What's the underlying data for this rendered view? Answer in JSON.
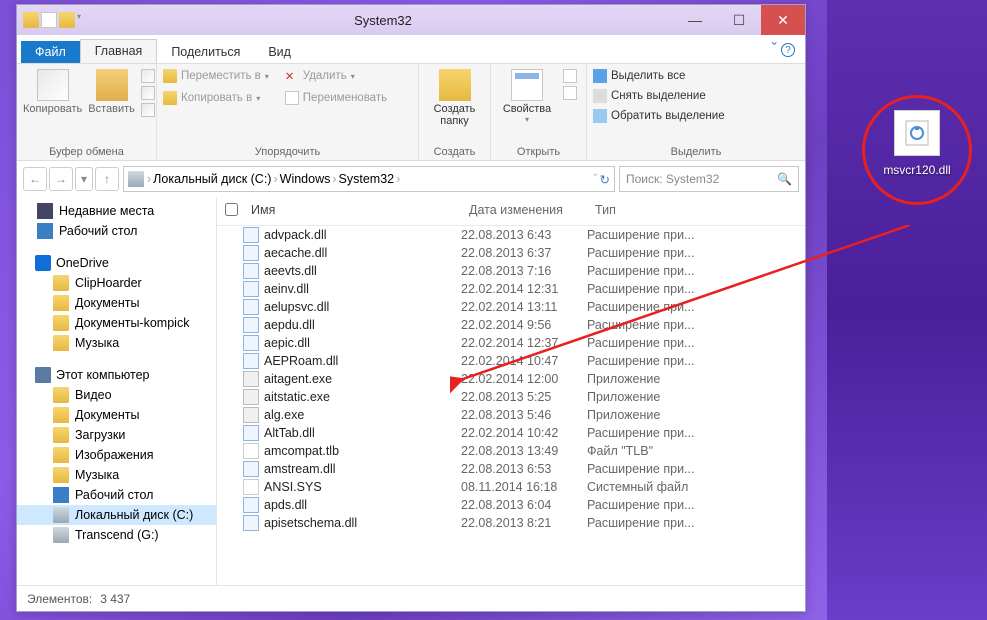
{
  "window": {
    "title": "System32"
  },
  "tabs": {
    "file": "Файл",
    "home": "Главная",
    "share": "Поделиться",
    "view": "Вид"
  },
  "ribbon": {
    "copy": "Копировать",
    "paste": "Вставить",
    "clipboard_group": "Буфер обмена",
    "move": "Переместить в",
    "copy_to": "Копировать в",
    "delete": "Удалить",
    "rename": "Переименовать",
    "organize_group": "Упорядочить",
    "newfolder_l1": "Создать",
    "newfolder_l2": "папку",
    "create_group": "Создать",
    "properties": "Свойства",
    "open_group": "Открыть",
    "select_all": "Выделить все",
    "deselect": "Снять выделение",
    "invert": "Обратить выделение",
    "select_group": "Выделить"
  },
  "breadcrumb": {
    "root": "Локальный диск (C:)",
    "windows": "Windows",
    "current": "System32"
  },
  "search": {
    "placeholder": "Поиск: System32"
  },
  "tree": {
    "recent": "Недавние места",
    "desktop": "Рабочий стол",
    "onedrive": "OneDrive",
    "cliphoarder": "ClipHoarder",
    "documents": "Документы",
    "documents_kompick": "Документы-kompick",
    "music": "Музыка",
    "this_pc": "Этот компьютер",
    "videos": "Видео",
    "documents2": "Документы",
    "downloads": "Загрузки",
    "pictures": "Изображения",
    "music2": "Музыка",
    "desktop2": "Рабочий стол",
    "cdrive": "Локальный диск (C:)",
    "transcend": "Transcend (G:)"
  },
  "cols": {
    "name": "Имя",
    "date": "Дата изменения",
    "type": "Тип"
  },
  "files": [
    {
      "name": "advpack.dll",
      "date": "22.08.2013 6:43",
      "type": "Расширение при...",
      "ico": "dll"
    },
    {
      "name": "aecache.dll",
      "date": "22.08.2013 6:37",
      "type": "Расширение при...",
      "ico": "dll"
    },
    {
      "name": "aeevts.dll",
      "date": "22.08.2013 7:16",
      "type": "Расширение при...",
      "ico": "dll"
    },
    {
      "name": "aeinv.dll",
      "date": "22.02.2014 12:31",
      "type": "Расширение при...",
      "ico": "dll"
    },
    {
      "name": "aelupsvc.dll",
      "date": "22.02.2014 13:11",
      "type": "Расширение при...",
      "ico": "dll"
    },
    {
      "name": "aepdu.dll",
      "date": "22.02.2014 9:56",
      "type": "Расширение при...",
      "ico": "dll"
    },
    {
      "name": "aepic.dll",
      "date": "22.02.2014 12:37",
      "type": "Расширение при...",
      "ico": "dll"
    },
    {
      "name": "AEPRoam.dll",
      "date": "22.02.2014 10:47",
      "type": "Расширение при...",
      "ico": "dll"
    },
    {
      "name": "aitagent.exe",
      "date": "22.02.2014 12:00",
      "type": "Приложение",
      "ico": "exe"
    },
    {
      "name": "aitstatic.exe",
      "date": "22.08.2013 5:25",
      "type": "Приложение",
      "ico": "exe"
    },
    {
      "name": "alg.exe",
      "date": "22.08.2013 5:46",
      "type": "Приложение",
      "ico": "exe"
    },
    {
      "name": "AltTab.dll",
      "date": "22.02.2014 10:42",
      "type": "Расширение при...",
      "ico": "dll"
    },
    {
      "name": "amcompat.tlb",
      "date": "22.08.2013 13:49",
      "type": "Файл \"TLB\"",
      "ico": "sys"
    },
    {
      "name": "amstream.dll",
      "date": "22.08.2013 6:53",
      "type": "Расширение при...",
      "ico": "dll"
    },
    {
      "name": "ANSI.SYS",
      "date": "08.11.2014 16:18",
      "type": "Системный файл",
      "ico": "sys"
    },
    {
      "name": "apds.dll",
      "date": "22.08.2013 6:04",
      "type": "Расширение при...",
      "ico": "dll"
    },
    {
      "name": "apisetschema.dll",
      "date": "22.08.2013 8:21",
      "type": "Расширение при...",
      "ico": "dll"
    }
  ],
  "status": {
    "elements_label": "Элементов:",
    "count": "3 437"
  },
  "desktop_file": {
    "label": "msvcr120.dll"
  }
}
